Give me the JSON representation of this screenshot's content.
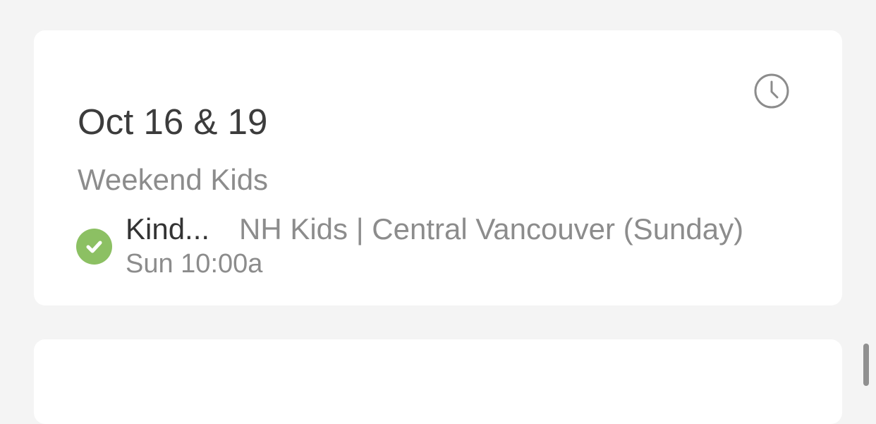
{
  "plan": {
    "dates": "Oct 16 & 19",
    "service_type": "Weekend Kids",
    "clock_icon": "clock-icon",
    "assignment": {
      "status_icon": "check-circle-icon",
      "status_color": "#8cc063",
      "role": "Kind...",
      "team": "NH Kids | Central Vancouver (Sunday)",
      "time": "Sun 10:00a"
    }
  }
}
